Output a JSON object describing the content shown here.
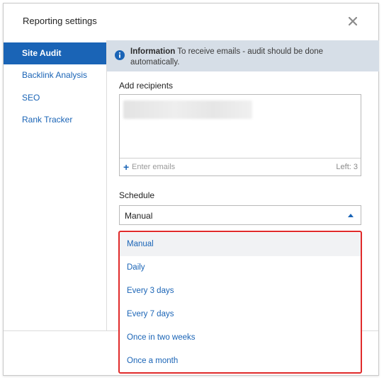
{
  "dialog": {
    "title": "Reporting settings"
  },
  "sidebar": {
    "items": [
      {
        "label": "Site Audit"
      },
      {
        "label": "Backlink Analysis"
      },
      {
        "label": "SEO"
      },
      {
        "label": "Rank Tracker"
      }
    ]
  },
  "info": {
    "heading": "Information",
    "message": " To receive emails - audit should be done automatically."
  },
  "recipients": {
    "label": "Add recipients",
    "placeholder": "Enter emails",
    "left_text": "Left: 3"
  },
  "schedule": {
    "label": "Schedule",
    "selected": "Manual",
    "options": [
      {
        "label": "Manual"
      },
      {
        "label": "Daily"
      },
      {
        "label": "Every 3 days"
      },
      {
        "label": "Every 7 days"
      },
      {
        "label": "Once in two weeks"
      },
      {
        "label": "Once a month"
      }
    ]
  },
  "colors": {
    "accent": "#1a64b6",
    "highlight_border": "#e02a2a",
    "info_background": "#d6dee7"
  }
}
